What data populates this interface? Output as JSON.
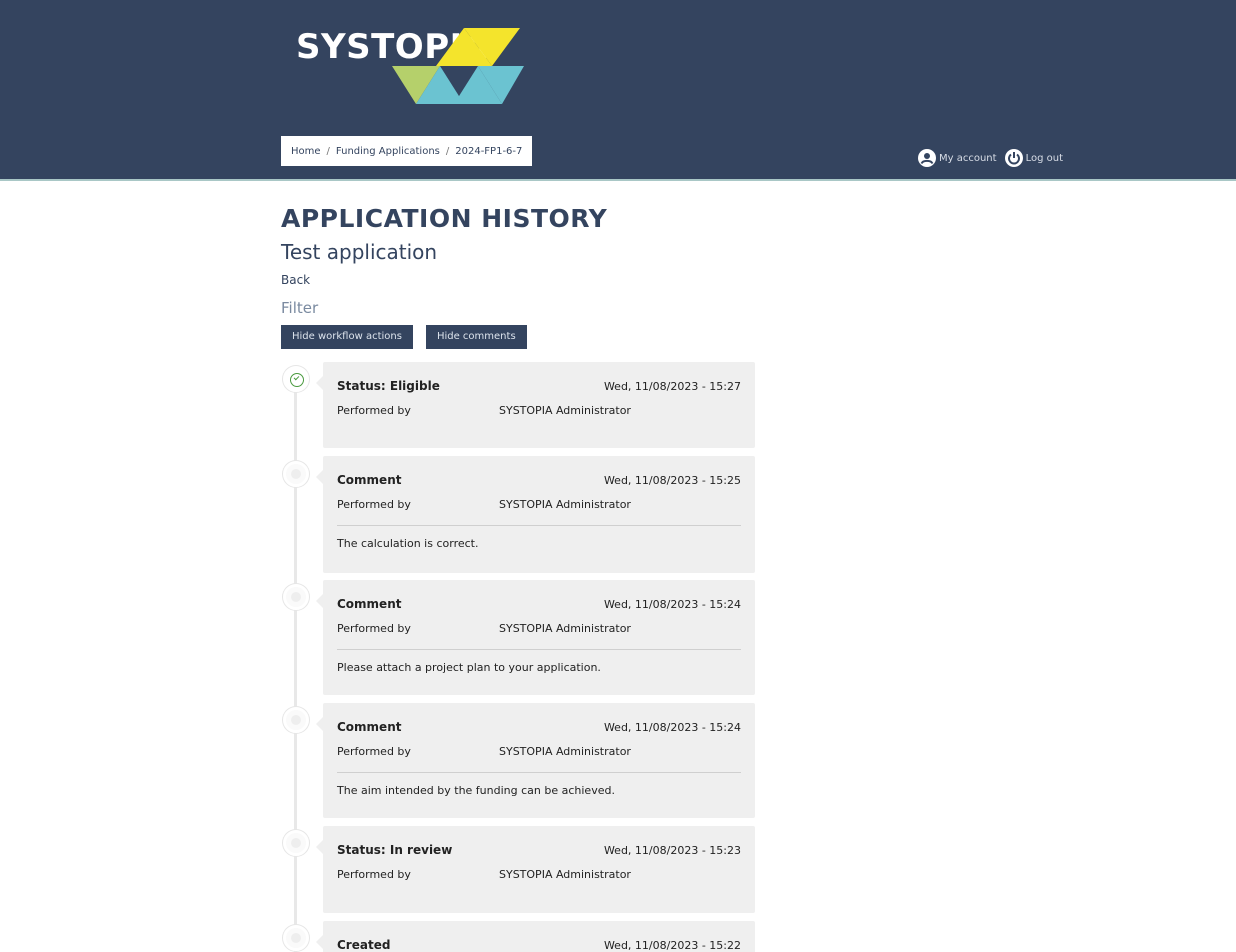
{
  "logo": {
    "text": "SYSTOPIA",
    "colors": {
      "yellow": "#f4e42c",
      "green": "#b5d06b",
      "cyan": "#6bc3d1"
    }
  },
  "breadcrumb": {
    "items": [
      "Home",
      "Funding Applications",
      "2024-FP1-6-7"
    ]
  },
  "account": {
    "my_account": "My account",
    "logout": "Log out"
  },
  "page": {
    "title": "APPLICATION HISTORY",
    "subtitle": "Test application",
    "back": "Back",
    "filter_label": "Filter",
    "btn_hide_workflow": "Hide workflow actions",
    "btn_hide_comments": "Hide comments"
  },
  "timeline": [
    {
      "title": "Status: Eligible",
      "date": "Wed, 11/08/2023 - 15:27",
      "performed_label": "Performed by",
      "performed_by": "SYSTOPIA Administrator",
      "body": ""
    },
    {
      "title": "Comment",
      "date": "Wed, 11/08/2023 - 15:25",
      "performed_label": "Performed by",
      "performed_by": "SYSTOPIA Administrator",
      "body": "The calculation is correct."
    },
    {
      "title": "Comment",
      "date": "Wed, 11/08/2023 - 15:24",
      "performed_label": "Performed by",
      "performed_by": "SYSTOPIA Administrator",
      "body": "Please attach a project plan to your application."
    },
    {
      "title": "Comment",
      "date": "Wed, 11/08/2023 - 15:24",
      "performed_label": "Performed by",
      "performed_by": "SYSTOPIA Administrator",
      "body": "The aim intended by the funding can be achieved."
    },
    {
      "title": "Status: In review",
      "date": "Wed, 11/08/2023 - 15:23",
      "performed_label": "Performed by",
      "performed_by": "SYSTOPIA Administrator",
      "body": ""
    },
    {
      "title": "Created",
      "date": "Wed, 11/08/2023 - 15:22",
      "performed_label": "",
      "performed_by": "",
      "body": ""
    }
  ]
}
